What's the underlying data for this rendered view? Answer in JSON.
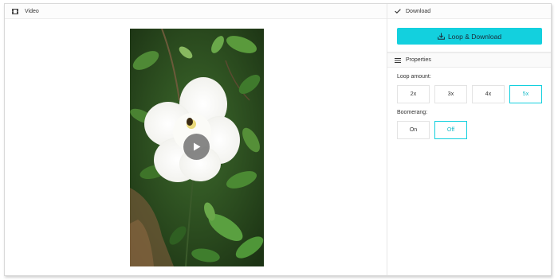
{
  "video_panel": {
    "title": "Video",
    "icon": "film-icon"
  },
  "download_panel": {
    "title": "Download",
    "icon": "check-icon",
    "button_label": "Loop & Download",
    "button_icon": "download-icon"
  },
  "properties_panel": {
    "title": "Properties",
    "icon": "menu-icon",
    "loop_amount": {
      "label": "Loop amount:",
      "options": [
        "2x",
        "3x",
        "4x",
        "5x"
      ],
      "selected": "5x"
    },
    "boomerang": {
      "label": "Boomerang:",
      "options": [
        "On",
        "Off"
      ],
      "selected": "Off"
    }
  },
  "colors": {
    "accent": "#13d0de"
  }
}
